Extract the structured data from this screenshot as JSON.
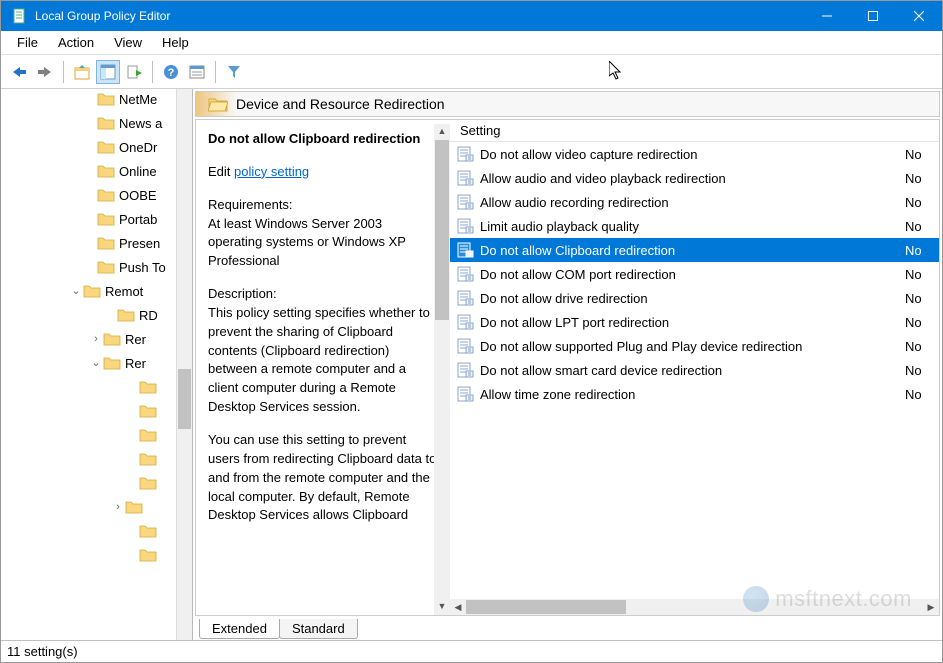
{
  "window": {
    "title": "Local Group Policy Editor"
  },
  "menu": {
    "file": "File",
    "action": "Action",
    "view": "View",
    "help": "Help"
  },
  "tree": {
    "items": [
      {
        "indent": 96,
        "expander": "",
        "label": "NetMe"
      },
      {
        "indent": 96,
        "expander": "",
        "label": "News a"
      },
      {
        "indent": 96,
        "expander": "",
        "label": "OneDr"
      },
      {
        "indent": 96,
        "expander": "",
        "label": "Online"
      },
      {
        "indent": 96,
        "expander": "",
        "label": "OOBE"
      },
      {
        "indent": 96,
        "expander": "",
        "label": "Portab"
      },
      {
        "indent": 96,
        "expander": "",
        "label": "Presen"
      },
      {
        "indent": 96,
        "expander": "",
        "label": "Push To"
      },
      {
        "indent": 82,
        "expander": "⌄",
        "label": "Remot"
      },
      {
        "indent": 116,
        "expander": "",
        "label": "RD"
      },
      {
        "indent": 102,
        "expander": "›",
        "label": "Rer"
      },
      {
        "indent": 102,
        "expander": "⌄",
        "label": "Rer"
      },
      {
        "indent": 138,
        "expander": "",
        "label": ""
      },
      {
        "indent": 138,
        "expander": "",
        "label": ""
      },
      {
        "indent": 138,
        "expander": "",
        "label": ""
      },
      {
        "indent": 138,
        "expander": "",
        "label": ""
      },
      {
        "indent": 138,
        "expander": "",
        "label": ""
      },
      {
        "indent": 124,
        "expander": "›",
        "label": ""
      },
      {
        "indent": 138,
        "expander": "",
        "label": ""
      },
      {
        "indent": 138,
        "expander": "",
        "label": ""
      }
    ]
  },
  "pane": {
    "header": "Device and Resource Redirection"
  },
  "desc": {
    "title": "Do not allow Clipboard redirection",
    "edit_prefix": "Edit ",
    "edit_link": "policy setting ",
    "req_label": "Requirements:",
    "req_text": "At least Windows Server 2003 operating systems or Windows XP Professional",
    "desc_label": "Description:",
    "desc_text1": "This policy setting specifies whether to prevent the sharing of Clipboard contents (Clipboard redirection) between a remote computer and a client computer during a Remote Desktop Services session.",
    "desc_text2": "You can use this setting to prevent users from redirecting Clipboard data to and from the remote computer and the local computer. By default, Remote Desktop Services allows Clipboard"
  },
  "settings": {
    "col_setting": "Setting",
    "rows": [
      {
        "label": "Do not allow video capture redirection",
        "state": "No",
        "selected": false
      },
      {
        "label": "Allow audio and video playback redirection",
        "state": "No",
        "selected": false
      },
      {
        "label": "Allow audio recording redirection",
        "state": "No",
        "selected": false
      },
      {
        "label": "Limit audio playback quality",
        "state": "No",
        "selected": false
      },
      {
        "label": "Do not allow Clipboard redirection",
        "state": "No",
        "selected": true
      },
      {
        "label": "Do not allow COM port redirection",
        "state": "No",
        "selected": false
      },
      {
        "label": "Do not allow drive redirection",
        "state": "No",
        "selected": false
      },
      {
        "label": "Do not allow LPT port redirection",
        "state": "No",
        "selected": false
      },
      {
        "label": "Do not allow supported Plug and Play device redirection",
        "state": "No",
        "selected": false
      },
      {
        "label": "Do not allow smart card device redirection",
        "state": "No",
        "selected": false
      },
      {
        "label": "Allow time zone redirection",
        "state": "No",
        "selected": false
      }
    ]
  },
  "tabs": {
    "extended": "Extended",
    "standard": "Standard"
  },
  "status": {
    "text": "11 setting(s)"
  },
  "watermark": {
    "text": "msftnext.com"
  }
}
